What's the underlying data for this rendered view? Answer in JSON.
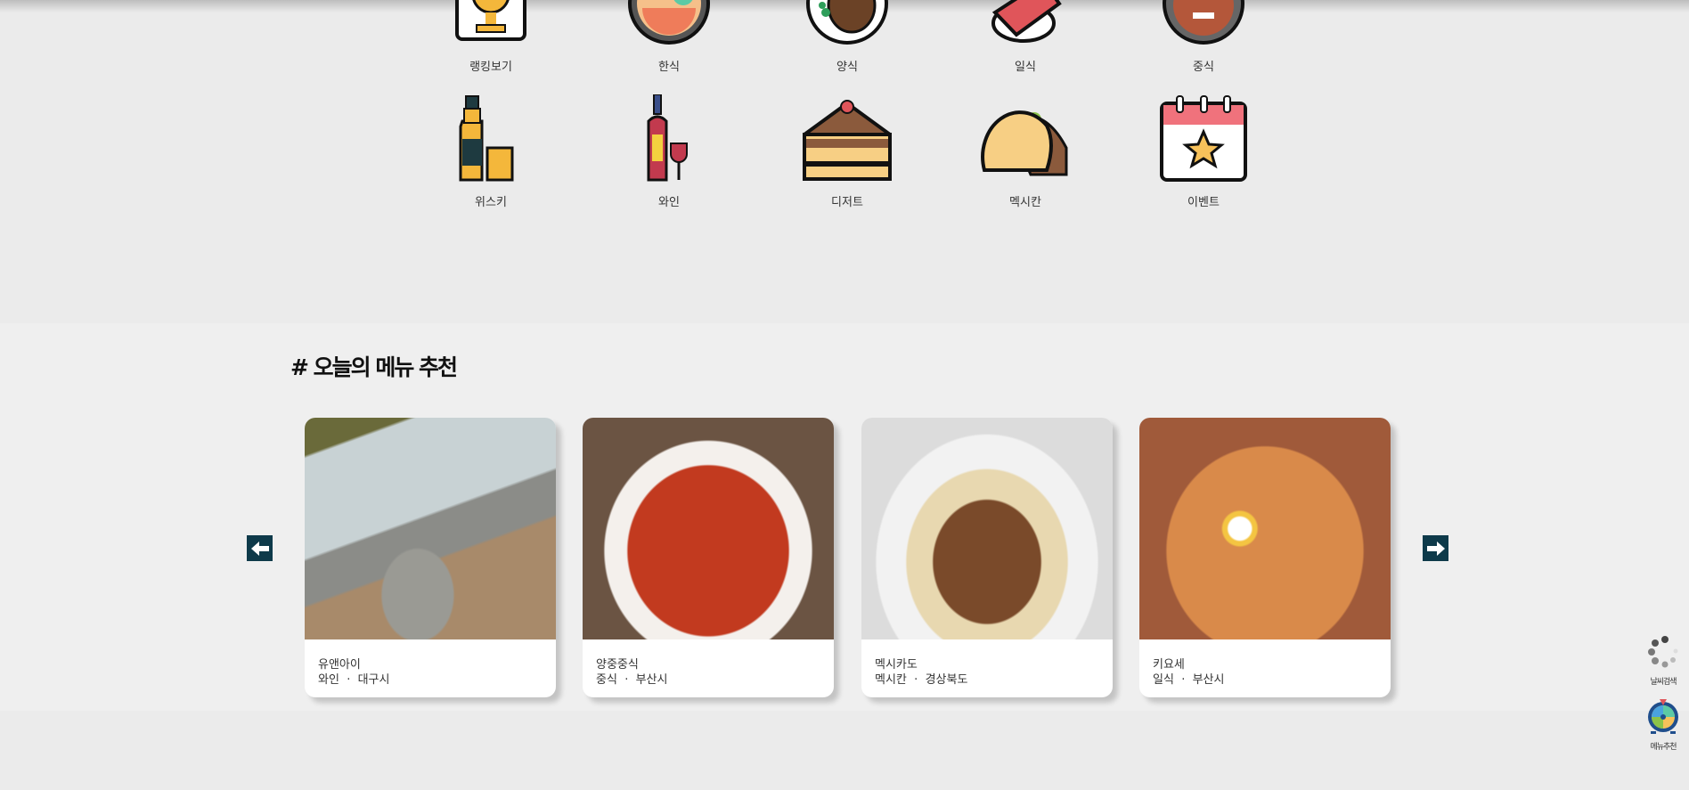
{
  "categories_row1": [
    {
      "label": "랭킹보기",
      "icon": "trophy-icon"
    },
    {
      "label": "한식",
      "icon": "bibimbap-icon"
    },
    {
      "label": "양식",
      "icon": "steak-icon"
    },
    {
      "label": "일식",
      "icon": "sushi-icon"
    },
    {
      "label": "중식",
      "icon": "noodle-bowl-icon"
    }
  ],
  "categories_row2": [
    {
      "label": "위스키",
      "icon": "whisky-icon"
    },
    {
      "label": "와인",
      "icon": "wine-icon"
    },
    {
      "label": "디저트",
      "icon": "cake-icon"
    },
    {
      "label": "멕시칸",
      "icon": "taco-icon"
    },
    {
      "label": "이벤트",
      "icon": "calendar-star-icon"
    }
  ],
  "recommend": {
    "title": "# 오늘의 메뉴 추천",
    "cards": [
      {
        "name": "유앤아이",
        "category": "와인",
        "separator": "·",
        "region": "대구시"
      },
      {
        "name": "양중중식",
        "category": "중식",
        "separator": "·",
        "region": "부산시"
      },
      {
        "name": "멕시카도",
        "category": "멕시칸",
        "separator": "·",
        "region": "경상북도"
      },
      {
        "name": "키요세",
        "category": "일식",
        "separator": "·",
        "region": "부산시"
      }
    ]
  },
  "floating": {
    "weather_label": "날씨검색",
    "menu_label": "메뉴추천"
  },
  "colors": {
    "arrow": "#0e3a4a",
    "background": "#ebebeb"
  }
}
